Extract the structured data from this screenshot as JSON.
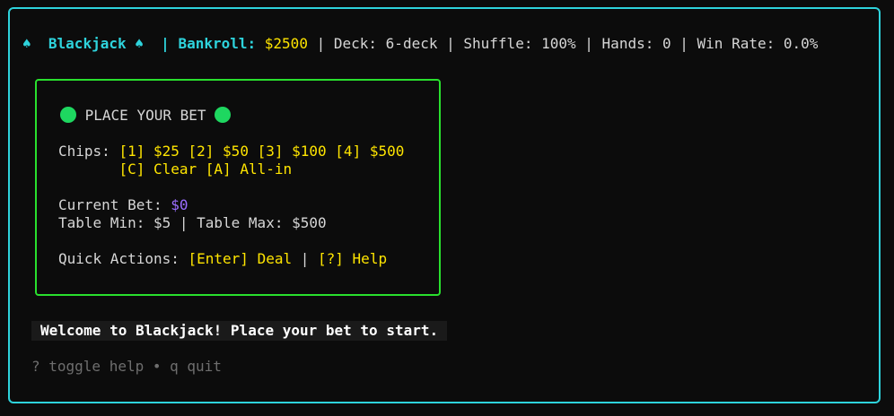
{
  "header": {
    "left_icon": "♠-suit-icon",
    "title": "Blackjack",
    "right_icon": "♠-suit-icon",
    "sep": "|",
    "bankroll_label": "Bankroll:",
    "bankroll_value": "$2500",
    "deck": "Deck: 6-deck",
    "shuffle": "Shuffle: 100%",
    "hands": "Hands: 0",
    "win_rate": "Win Rate: 0.0%"
  },
  "bet_panel": {
    "title": "PLACE YOUR BET",
    "chips_label": "Chips:",
    "chips": [
      "[1] $25",
      "[2] $50",
      "[3] $100",
      "[4] $500"
    ],
    "clear": "[C] Clear",
    "all_in": "[A] All-in",
    "current_bet_label": "Current Bet:",
    "current_bet_value": "$0",
    "table_limits": "Table Min: $5 | Table Max: $500",
    "quick_actions_label": "Quick Actions:",
    "deal": "[Enter] Deal",
    "help": "[?] Help",
    "sep": "|"
  },
  "message": "Welcome to Blackjack! Place your bet to start.",
  "footer_help": "? toggle help • q quit",
  "colors": {
    "border": "#2ed3dc",
    "panel_border": "#29e02e",
    "accent": "#ffe500",
    "bet_value": "#9b6dff"
  }
}
